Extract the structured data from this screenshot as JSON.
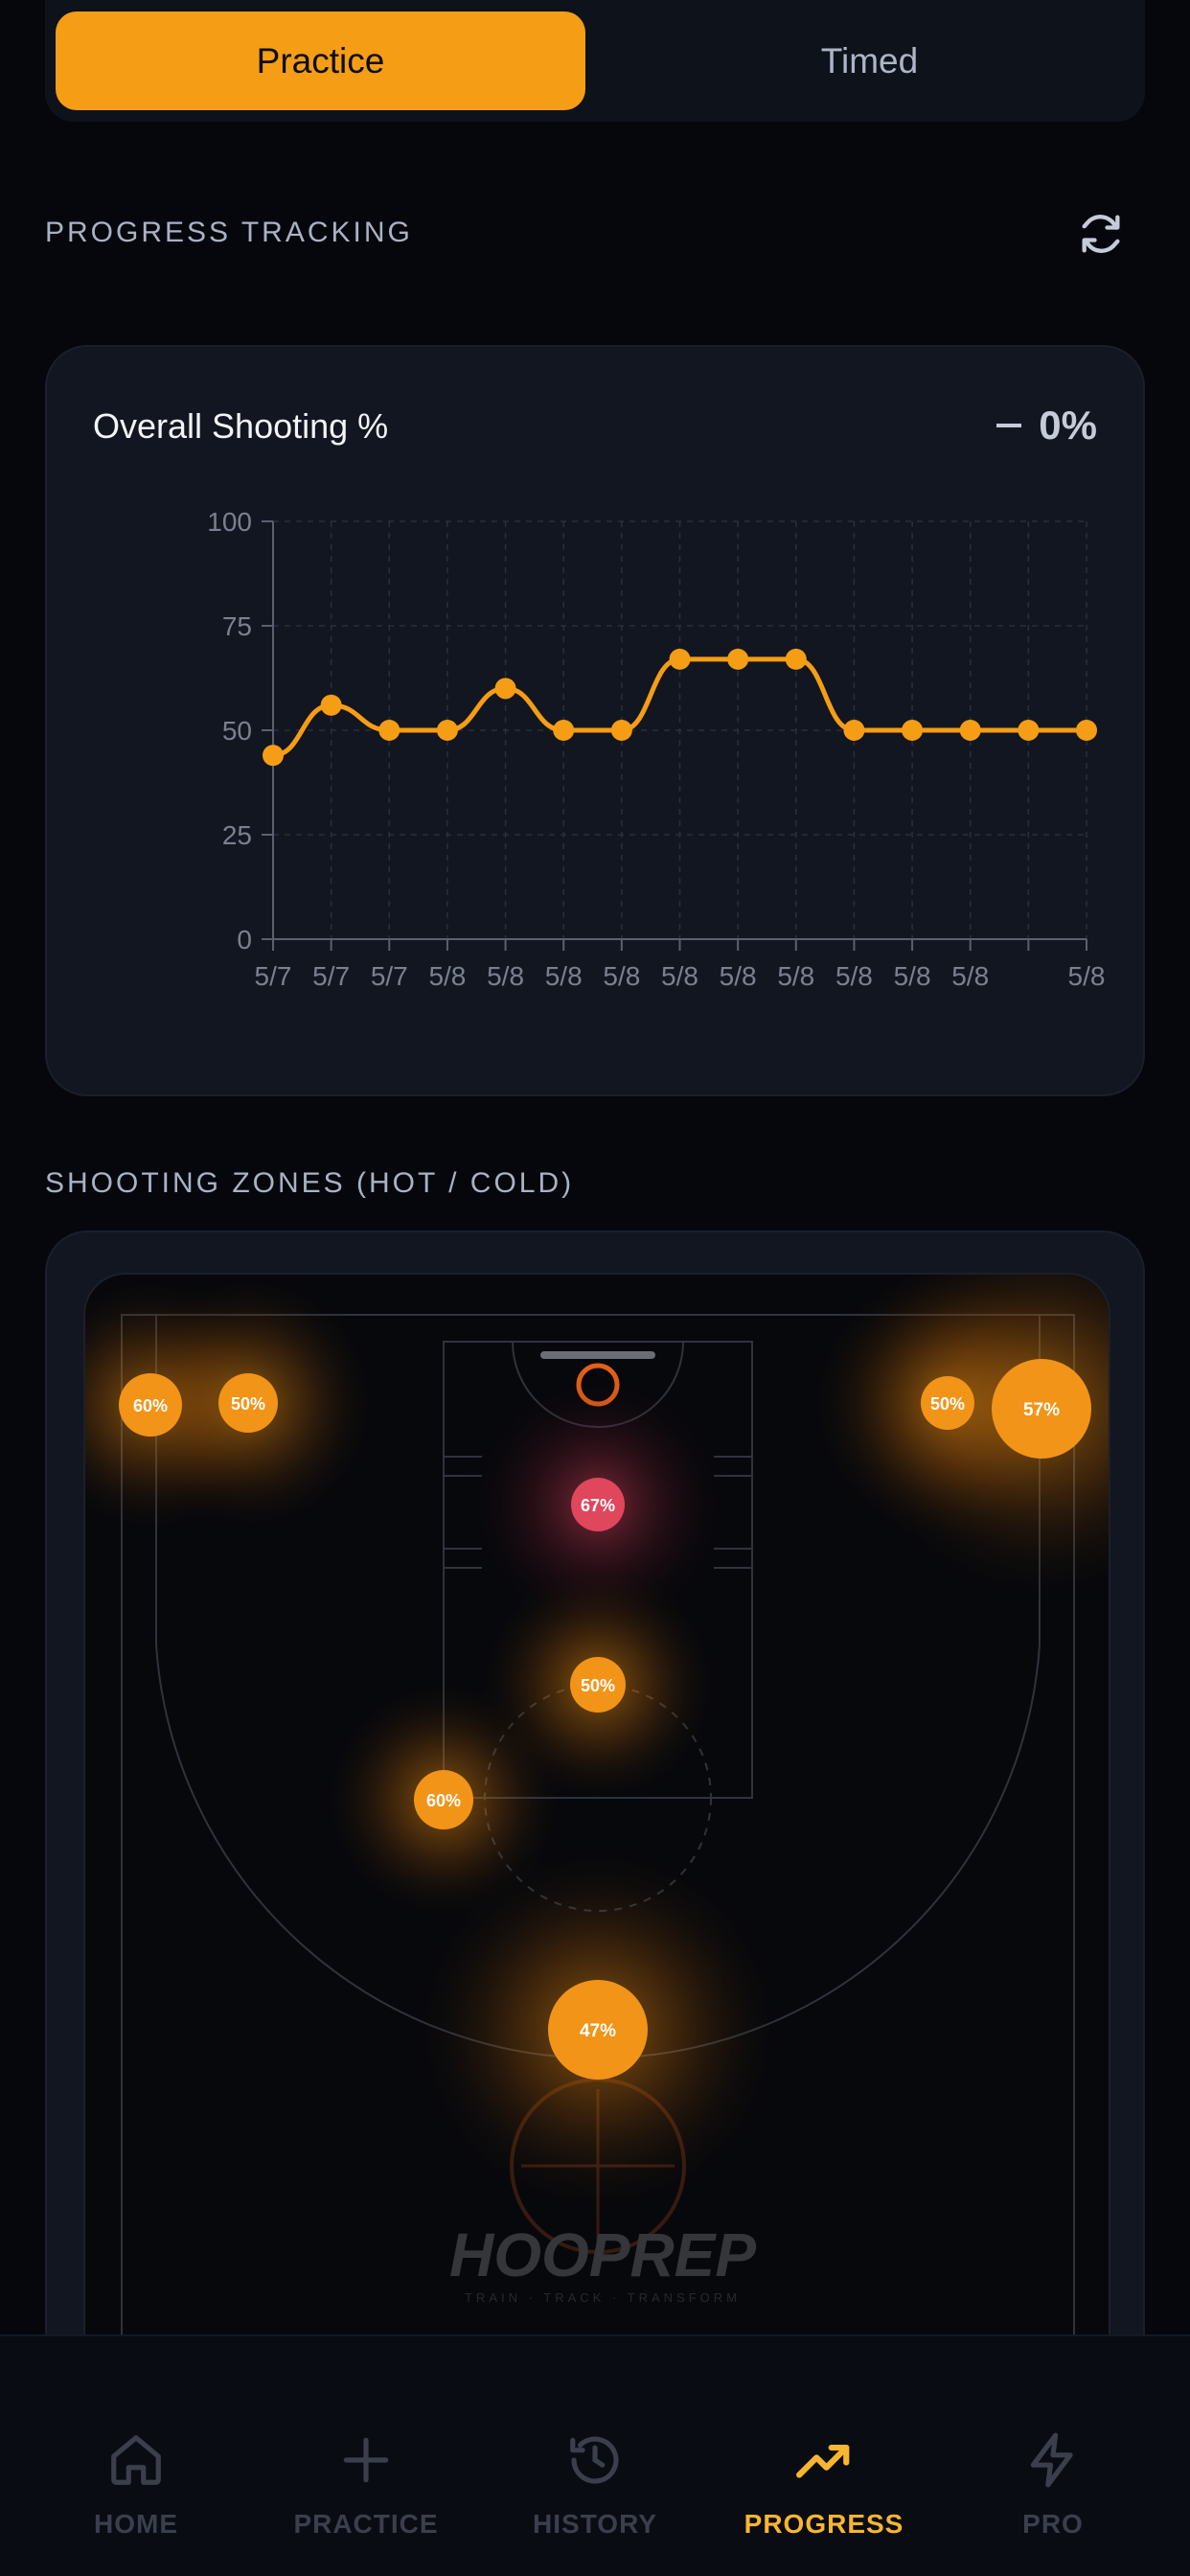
{
  "mode_toggle": {
    "options": [
      "Practice",
      "Timed"
    ],
    "selected": "Practice"
  },
  "progress": {
    "section_label": "PROGRESS TRACKING",
    "refresh_icon": "refresh-icon"
  },
  "chart_card": {
    "title": "Overall Shooting %",
    "delta": "0%"
  },
  "chart_data": {
    "type": "line",
    "title": "Overall Shooting %",
    "x": [
      "5/7",
      "5/7",
      "5/7",
      "5/8",
      "5/8",
      "5/8",
      "5/8",
      "5/8",
      "5/8",
      "5/8",
      "5/8",
      "5/8",
      "5/8",
      "5/8",
      "5/8"
    ],
    "x_tick_labels": [
      "5/7",
      "5/7",
      "5/7",
      "5/8",
      "5/8",
      "5/8",
      "5/8",
      "5/8",
      "5/8",
      "5/8",
      "5/8",
      "5/8",
      "5/8",
      "",
      "5/8"
    ],
    "series": [
      {
        "values": [
          44,
          56,
          50,
          50,
          60,
          50,
          50,
          67,
          67,
          67,
          50,
          50,
          50,
          50,
          50
        ]
      }
    ],
    "ylim": [
      0,
      100
    ],
    "yticks": [
      0,
      25,
      50,
      75,
      100
    ],
    "grid": true,
    "color": "#f59d14"
  },
  "zones": {
    "section_label": "SHOOTING ZONES (HOT / COLD)",
    "items": [
      {
        "name": "left-corner",
        "value": "60%"
      },
      {
        "name": "left-wing-corner",
        "value": "50%"
      },
      {
        "name": "right-wing-corner",
        "value": "50%"
      },
      {
        "name": "right-corner",
        "value": "57%"
      },
      {
        "name": "paint",
        "value": "67%"
      },
      {
        "name": "free-throw",
        "value": "50%"
      },
      {
        "name": "left-elbow",
        "value": "60%"
      },
      {
        "name": "top-of-key",
        "value": "47%"
      }
    ],
    "watermark": {
      "brand": "HOOPREP",
      "tagline": "TRAIN · TRACK · TRANSFORM"
    }
  },
  "nav": {
    "items": [
      {
        "label": "HOME",
        "icon": "home-icon"
      },
      {
        "label": "PRACTICE",
        "icon": "plus-icon"
      },
      {
        "label": "HISTORY",
        "icon": "history-icon"
      },
      {
        "label": "PROGRESS",
        "icon": "trending-up-icon"
      },
      {
        "label": "PRO",
        "icon": "lightning-icon"
      }
    ],
    "active": "PROGRESS"
  },
  "colors": {
    "accent": "#f59d14",
    "hot": "#e0465c",
    "background": "#05070d"
  }
}
